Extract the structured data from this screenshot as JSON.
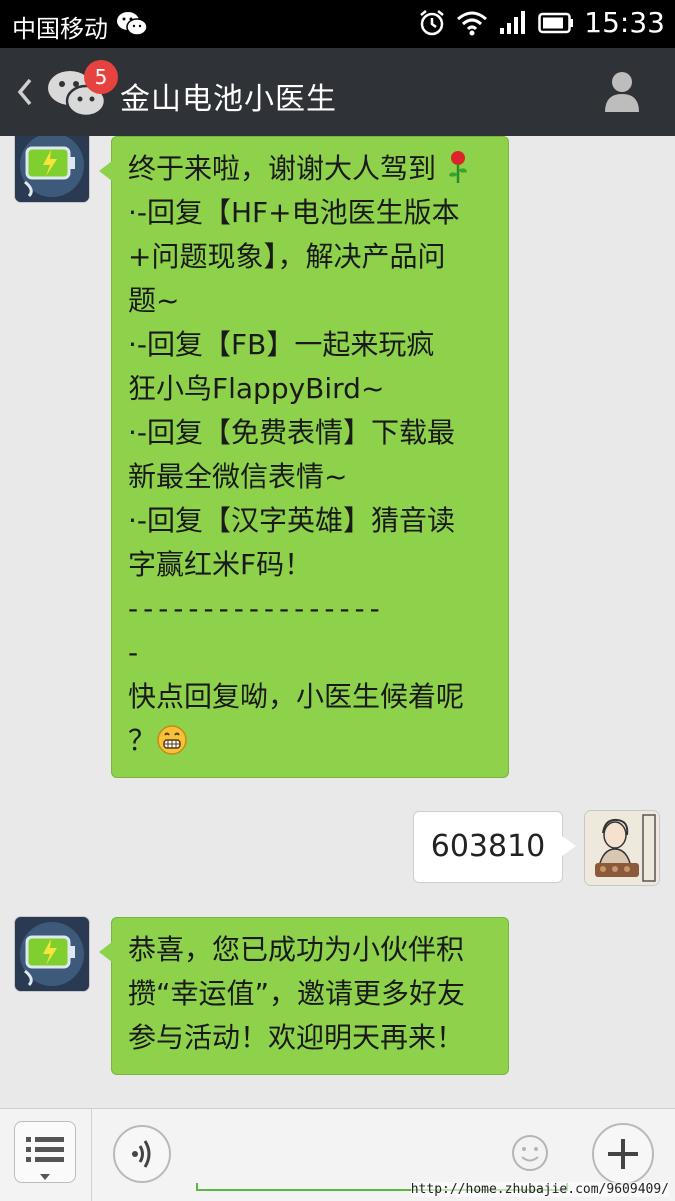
{
  "status": {
    "carrier": "中国移动",
    "time": "15:33"
  },
  "header": {
    "title": "金山电池小医生",
    "unread_badge": "5"
  },
  "messages": [
    {
      "from": "official-account",
      "lines": [
        "终于来啦，谢谢大人驾到",
        "·-回复【HF+电池医生版本",
        "+问题现象】，解决产品问",
        "题~",
        "·-回复【FB】一起来玩疯",
        "狂小鸟FlappyBird~",
        "·-回复【免费表情】下载最",
        "新最全微信表情~",
        "·-回复【汉字英雄】猜音读",
        "字赢红米F码！",
        "-----------------",
        "-",
        "快点回复呦，小医生候着呢",
        "？"
      ]
    },
    {
      "from": "me",
      "text": "603810"
    },
    {
      "from": "official-account",
      "lines": [
        "恭喜，您已成功为小伙伴积",
        "攒“幸运值”，邀请更多好友",
        "参与活动！欢迎明天再来！"
      ]
    }
  ],
  "watermark": "http://home.zhubajie.com/9609409/",
  "icons": {
    "back": "chevron-left-icon",
    "wechat": "wechat-logo-icon",
    "profile": "person-icon",
    "menu": "list-menu-icon",
    "voice": "voice-wave-icon",
    "emoji": "smiley-icon",
    "plus": "plus-icon",
    "rose": "rose-emoji",
    "grin": "grin-emoji"
  },
  "colors": {
    "incoming_bubble": "#8ed14a",
    "title_bar": "#2f3236",
    "badge": "#e64340",
    "background": "#e9e9e9"
  }
}
